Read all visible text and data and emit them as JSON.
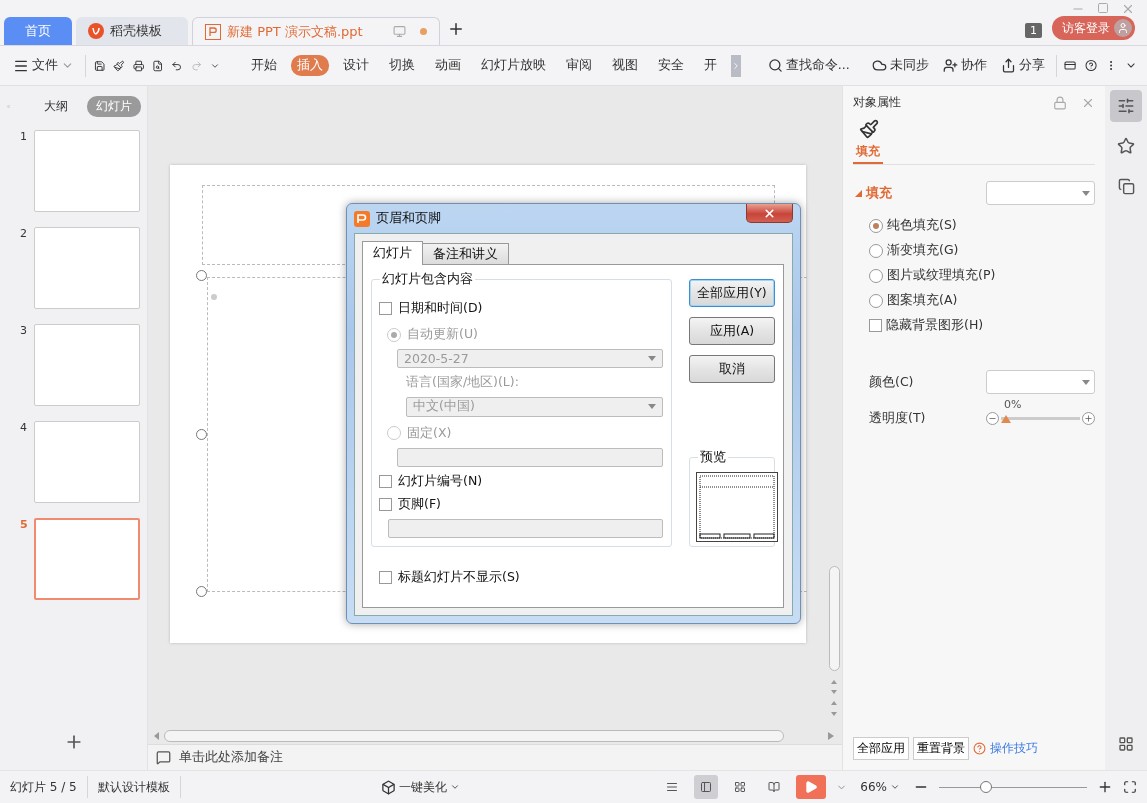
{
  "tabs": [
    {
      "label": "首页",
      "kind": "home",
      "selected": false
    },
    {
      "label": "稻壳模板",
      "kind": "docer",
      "selected": false
    },
    {
      "label": "新建 PPT 演示文稿.ppt",
      "kind": "doc",
      "selected": true,
      "unsaved": true
    }
  ],
  "window_count": "1",
  "login_button": "访客登录",
  "file_menu": "文件",
  "ribbon_tabs": [
    {
      "label": "开始",
      "selected": false
    },
    {
      "label": "插入",
      "selected": true
    },
    {
      "label": "设计",
      "selected": false
    },
    {
      "label": "切换",
      "selected": false
    },
    {
      "label": "动画",
      "selected": false
    },
    {
      "label": "幻灯片放映",
      "selected": false
    },
    {
      "label": "审阅",
      "selected": false
    },
    {
      "label": "视图",
      "selected": false
    },
    {
      "label": "安全",
      "selected": false
    },
    {
      "label": "开",
      "selected": false
    }
  ],
  "search": {
    "placeholder": "查找命令..."
  },
  "toolbar_right": {
    "sync": "未同步",
    "collaborate": "协作",
    "share": "分享"
  },
  "sidebar": {
    "tabs": [
      {
        "label": "大纲",
        "selected": false
      },
      {
        "label": "幻灯片",
        "selected": true
      }
    ],
    "slides": [
      {
        "number": "1",
        "selected": false
      },
      {
        "number": "2",
        "selected": false
      },
      {
        "number": "3",
        "selected": false
      },
      {
        "number": "4",
        "selected": false
      },
      {
        "number": "5",
        "selected": true
      }
    ]
  },
  "notes_placeholder": "单击此处添加备注",
  "dialog": {
    "title": "页眉和页脚",
    "tabs": [
      {
        "label": "幻灯片",
        "selected": true
      },
      {
        "label": "备注和讲义",
        "selected": false
      }
    ],
    "group_label": "幻灯片包含内容",
    "date_time": {
      "label": "日期和时间(D)",
      "checked": false
    },
    "auto_update": {
      "label": "自动更新(U)",
      "selected": true,
      "disabled": true
    },
    "date_value": "2020-5-27",
    "language_label": "语言(国家/地区)(L):",
    "language_value": "中文(中国)",
    "fixed": {
      "label": "固定(X)",
      "selected": false,
      "disabled": true
    },
    "slide_number": {
      "label": "幻灯片编号(N)",
      "checked": false
    },
    "footer": {
      "label": "页脚(F)",
      "checked": false
    },
    "hide_on_title": {
      "label": "标题幻灯片不显示(S)",
      "checked": false
    },
    "buttons": [
      {
        "label": "全部应用(Y)",
        "kind": "default"
      },
      {
        "label": "应用(A)",
        "kind": "normal"
      },
      {
        "label": "取消",
        "kind": "normal"
      }
    ],
    "preview_label": "预览"
  },
  "properties": {
    "title": "对象属性",
    "tab": {
      "label": "填充",
      "selected": true
    },
    "section": {
      "label": "填充",
      "expanded": true
    },
    "fill_options": [
      {
        "label": "纯色填充(S)",
        "selected": true
      },
      {
        "label": "渐变填充(G)",
        "selected": false
      },
      {
        "label": "图片或纹理填充(P)",
        "selected": false
      },
      {
        "label": "图案填充(A)",
        "selected": false
      }
    ],
    "hide_background": {
      "label": "隐藏背景图形(H)",
      "checked": false
    },
    "color_label": "颜色(C)",
    "transparency_label": "透明度(T)",
    "transparency_reading": "0%",
    "transparency": {
      "level": 0
    },
    "bottom_buttons": [
      "全部应用",
      "重置背景"
    ],
    "tips_link": "操作技巧"
  },
  "status_bar": {
    "slide": "幻灯片 5 / 5",
    "template": "默认设计模板",
    "beautify": "一键美化",
    "zoom": "66%",
    "zoom_slider": {
      "level": 0.3
    }
  }
}
